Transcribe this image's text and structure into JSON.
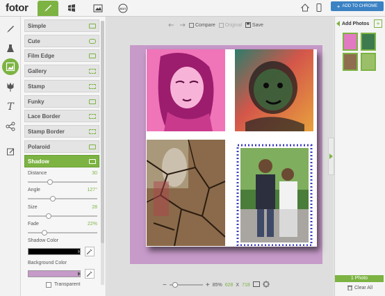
{
  "app": {
    "logo": "fotor"
  },
  "top_tabs": [
    {
      "icon": "brush-icon"
    },
    {
      "icon": "windows-icon"
    },
    {
      "icon": "image-icon"
    },
    {
      "icon": "edit-badge-icon",
      "label": "EDIT"
    }
  ],
  "top_right": {
    "chrome_button": "ADD TO CHROME"
  },
  "rail": [
    {
      "icon": "brush-icon"
    },
    {
      "icon": "flask-icon"
    },
    {
      "icon": "image-frame-icon",
      "active": true
    },
    {
      "icon": "tulip-icon"
    },
    {
      "icon": "text-icon",
      "label": "T"
    },
    {
      "icon": "share-icon"
    },
    {
      "icon": "pencil-note-icon"
    }
  ],
  "styles": [
    {
      "label": "Simple"
    },
    {
      "label": "Cute"
    },
    {
      "label": "Film Edge"
    },
    {
      "label": "Gallery"
    },
    {
      "label": "Stamp"
    },
    {
      "label": "Funky"
    },
    {
      "label": "Lace Border"
    },
    {
      "label": "Stamp Border"
    },
    {
      "label": "Polaroid"
    },
    {
      "label": "Shadow"
    }
  ],
  "properties": {
    "distance": {
      "label": "Distance",
      "value": "30",
      "level": 0.3
    },
    "angle": {
      "label": "Angle",
      "value": "127°",
      "level": 0.35
    },
    "size": {
      "label": "Size",
      "value": "28",
      "level": 0.28
    },
    "fade": {
      "label": "Fade",
      "value": "22%",
      "level": 0.22
    }
  },
  "shadow_color": {
    "label": "Shadow Color",
    "color": "#000000"
  },
  "background_color": {
    "label": "Background Color",
    "color": "#c69ac9"
  },
  "transparent": {
    "label": "Transparent"
  },
  "toolbar": {
    "undo": "undo-icon",
    "redo": "redo-icon",
    "compare": "Compare",
    "original": "Original",
    "save": "Save"
  },
  "zoom": {
    "percent": "85%",
    "width": "628",
    "x": "X",
    "height": "718"
  },
  "right_panel": {
    "add_photos": "Add Photos",
    "count": "1 Photo",
    "clear_all": "Clear All"
  },
  "colors": {
    "accent": "#7cb342",
    "stage_background": "#c69ac9"
  }
}
